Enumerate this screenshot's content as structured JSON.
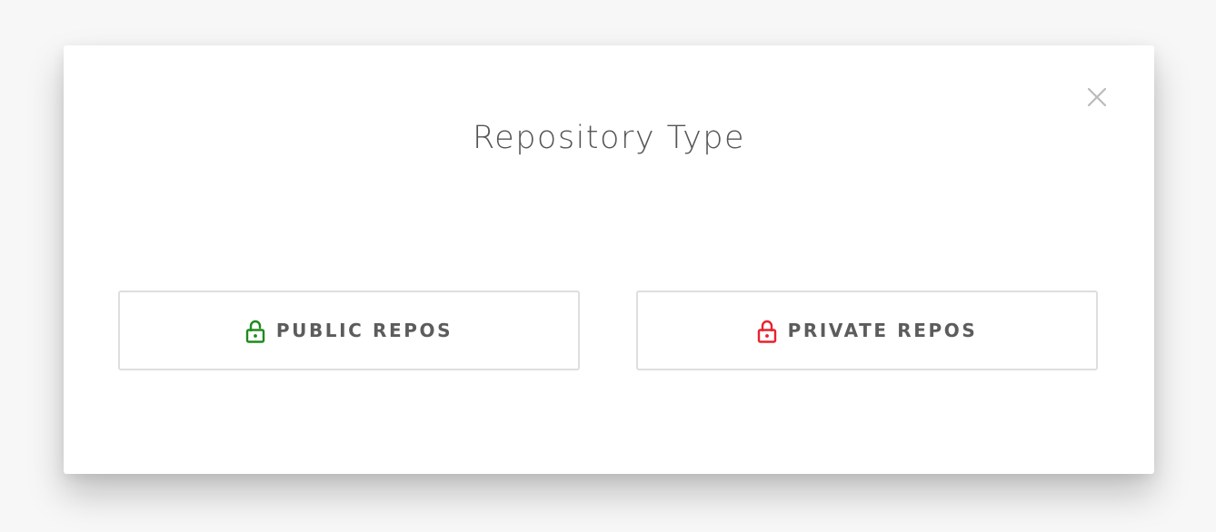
{
  "dialog": {
    "title": "Repository Type",
    "close_icon": "close-icon",
    "options": [
      {
        "label": "PUBLIC REPOS",
        "icon": "unlocked-icon",
        "icon_color": "#1f8a1f"
      },
      {
        "label": "PRIVATE REPOS",
        "icon": "locked-icon",
        "icon_color": "#e8222e"
      }
    ]
  },
  "colors": {
    "title_text": "#555555",
    "button_text": "#5c5c5c",
    "button_border": "#dedede",
    "close_icon": "#bbbbbb"
  }
}
